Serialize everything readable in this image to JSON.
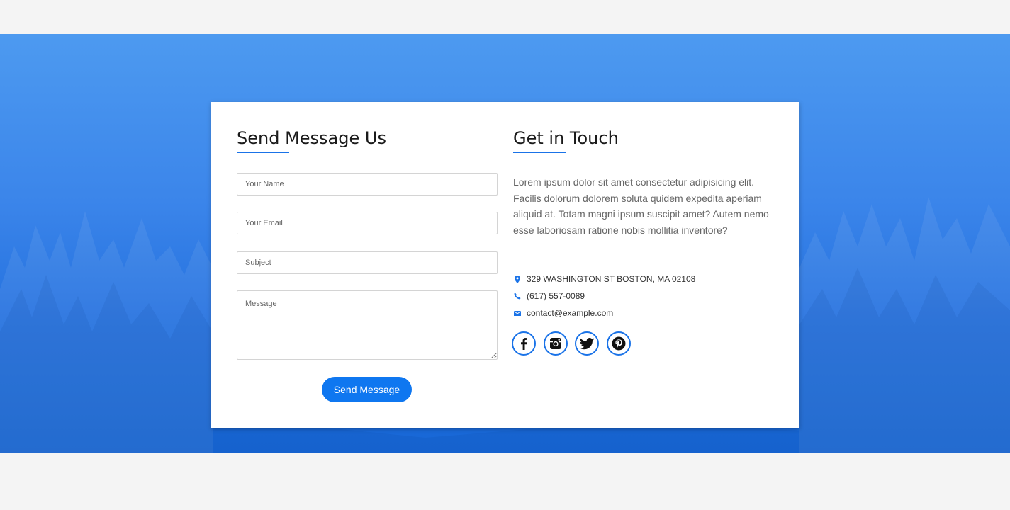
{
  "contact_form": {
    "title": "Send Message Us",
    "name_placeholder": "Your Name",
    "email_placeholder": "Your Email",
    "subject_placeholder": "Subject",
    "message_placeholder": "Message",
    "submit_label": "Send Message"
  },
  "get_in_touch": {
    "title": "Get in Touch",
    "description": "Lorem ipsum dolor sit amet consectetur adipisicing elit. Facilis dolorum dolorem soluta quidem expedita aperiam aliquid at. Totam magni ipsum suscipit amet? Autem nemo esse laboriosam ratione nobis mollitia inventore?",
    "address": "329 WASHINGTON ST BOSTON, MA 02108",
    "phone": "(617) 557-0089",
    "email": "contact@example.com",
    "socials": [
      {
        "icon": "facebook-icon"
      },
      {
        "icon": "instagram-icon"
      },
      {
        "icon": "twitter-icon"
      },
      {
        "icon": "pinterest-icon"
      }
    ]
  },
  "colors": {
    "accent": "#1a73e8",
    "button": "#0f77f0",
    "hero_top": "#4d9af0",
    "hero_bottom": "#1767d6",
    "page_bg": "#f4f4f4"
  }
}
